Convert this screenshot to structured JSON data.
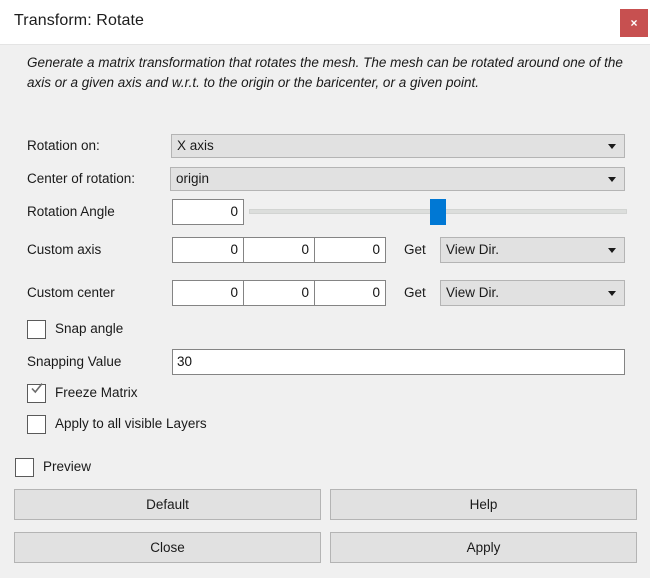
{
  "window": {
    "title": "Transform: Rotate",
    "close_label": "×",
    "close_icon": "close-icon",
    "accent_red": "#c75050",
    "accent_blue": "#0078d4"
  },
  "description": "Generate a matrix transformation that rotates the mesh. The mesh can be rotated around one of the axis or a given axis and w.r.t. to the origin or the baricenter, or a given point.",
  "form": {
    "rotation_on": {
      "label": "Rotation on:",
      "value": "X axis"
    },
    "center_of_rotation": {
      "label": "Center of rotation:",
      "value": "origin"
    },
    "rotation_angle": {
      "label": "Rotation Angle",
      "value": "0",
      "slider_percent": 50
    },
    "custom_axis": {
      "label": "Custom axis",
      "values": [
        "0",
        "0",
        "0"
      ],
      "get_label": "Get",
      "get_value": "View Dir."
    },
    "custom_center": {
      "label": "Custom center",
      "values": [
        "0",
        "0",
        "0"
      ],
      "get_label": "Get",
      "get_value": "View Dir."
    },
    "snap_angle": {
      "label": "Snap angle",
      "checked": false
    },
    "snapping_value": {
      "label": "Snapping Value",
      "value": "30"
    },
    "freeze_matrix": {
      "label": "Freeze Matrix",
      "checked": true
    },
    "apply_all_layers": {
      "label": "Apply to all visible Layers",
      "checked": false
    },
    "preview": {
      "label": "Preview",
      "checked": false
    }
  },
  "buttons": {
    "default": "Default",
    "help": "Help",
    "close": "Close",
    "apply": "Apply"
  }
}
